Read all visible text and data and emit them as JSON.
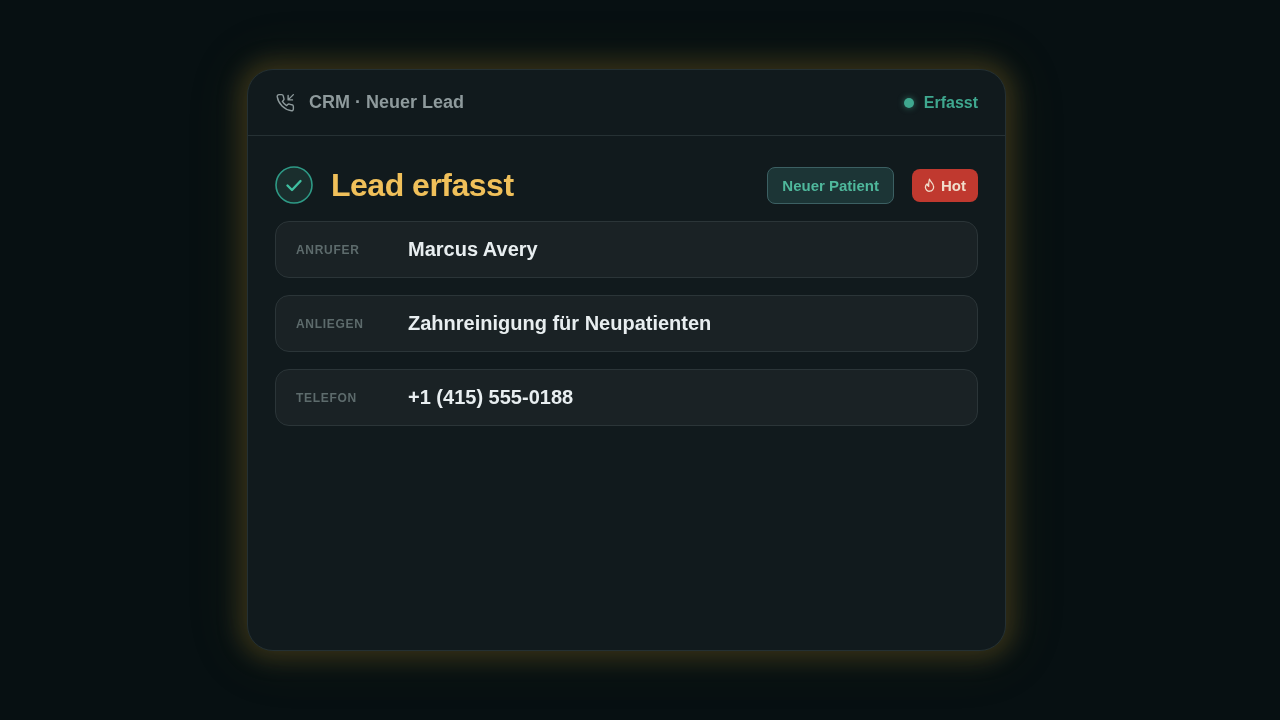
{
  "header": {
    "title": "CRM · Neuer Lead",
    "status": "Erfasst"
  },
  "heading": {
    "title": "Lead erfasst"
  },
  "tags": [
    {
      "label": "Neuer Patient",
      "kind": "outline"
    },
    {
      "label": "Hot",
      "kind": "hot"
    }
  ],
  "fields": [
    {
      "label": "ANRUFER",
      "value": "Marcus Avery"
    },
    {
      "label": "ANLIEGEN",
      "value": "Zahnreinigung für Neupatienten"
    },
    {
      "label": "TELEFON",
      "value": "+1 (415) 555-0188"
    }
  ]
}
